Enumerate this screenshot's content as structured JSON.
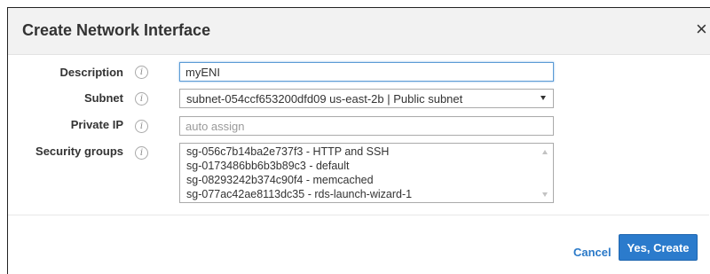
{
  "dialog": {
    "title": "Create Network Interface",
    "close_glyph": "×"
  },
  "form": {
    "description": {
      "label": "Description",
      "value": "myENI",
      "placeholder": ""
    },
    "subnet": {
      "label": "Subnet",
      "value": "subnet-054ccf653200dfd09 us-east-2b | Public subnet"
    },
    "private_ip": {
      "label": "Private IP",
      "value": "",
      "placeholder": "auto assign"
    },
    "security_groups": {
      "label": "Security groups",
      "options": [
        "sg-056c7b14ba2e737f3 - HTTP and SSH",
        "sg-0173486bb6b3b89c3 - default",
        "sg-08293242b374c90f4 - memcached",
        "sg-077ac42ae8113dc35 - rds-launch-wizard-1"
      ]
    },
    "info_glyph": "i"
  },
  "footer": {
    "cancel_label": "Cancel",
    "create_label": "Yes, Create"
  },
  "colors": {
    "primary_button": "#2b7bcc",
    "link": "#2a79c8",
    "header_bg": "#f2f2f2",
    "focus_border": "#5b9bd5"
  },
  "icons": {
    "close": "close-icon",
    "info": "info-icon",
    "dropdown": "chevron-down-icon",
    "scroll_up": "scroll-up-arrow-icon",
    "scroll_down": "scroll-down-arrow-icon"
  }
}
